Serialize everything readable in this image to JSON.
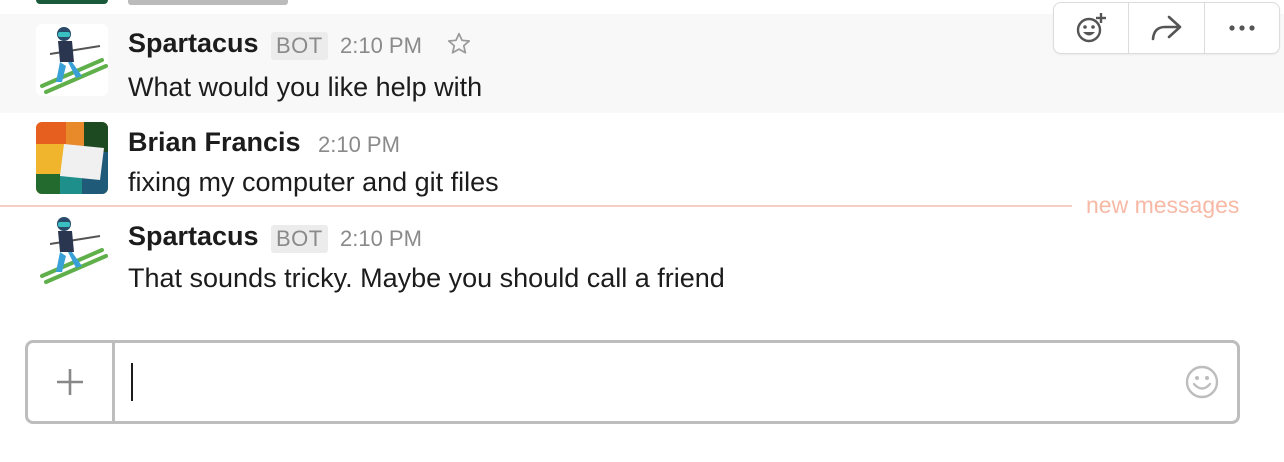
{
  "messages": [
    {
      "author": "Spartacus",
      "badge": "BOT",
      "time": "2:10 PM",
      "text": "What would you like help with"
    },
    {
      "author": "Brian Francis",
      "time": "2:10 PM",
      "text": "fixing my computer and git files"
    },
    {
      "author": "Spartacus",
      "badge": "BOT",
      "time": "2:10 PM",
      "text": "That sounds tricky. Maybe you should call a friend"
    }
  ],
  "divider": {
    "label": "new messages"
  },
  "actions": {
    "icons": [
      "add-reaction-icon",
      "share-icon",
      "more-icon"
    ]
  },
  "composer": {
    "value": "",
    "placeholder": ""
  },
  "colors": {
    "divider": "#f6cfc4",
    "divider_text": "#f7b9a6",
    "hover_bg": "#f8f8f8",
    "muted": "#8a8a8a"
  }
}
